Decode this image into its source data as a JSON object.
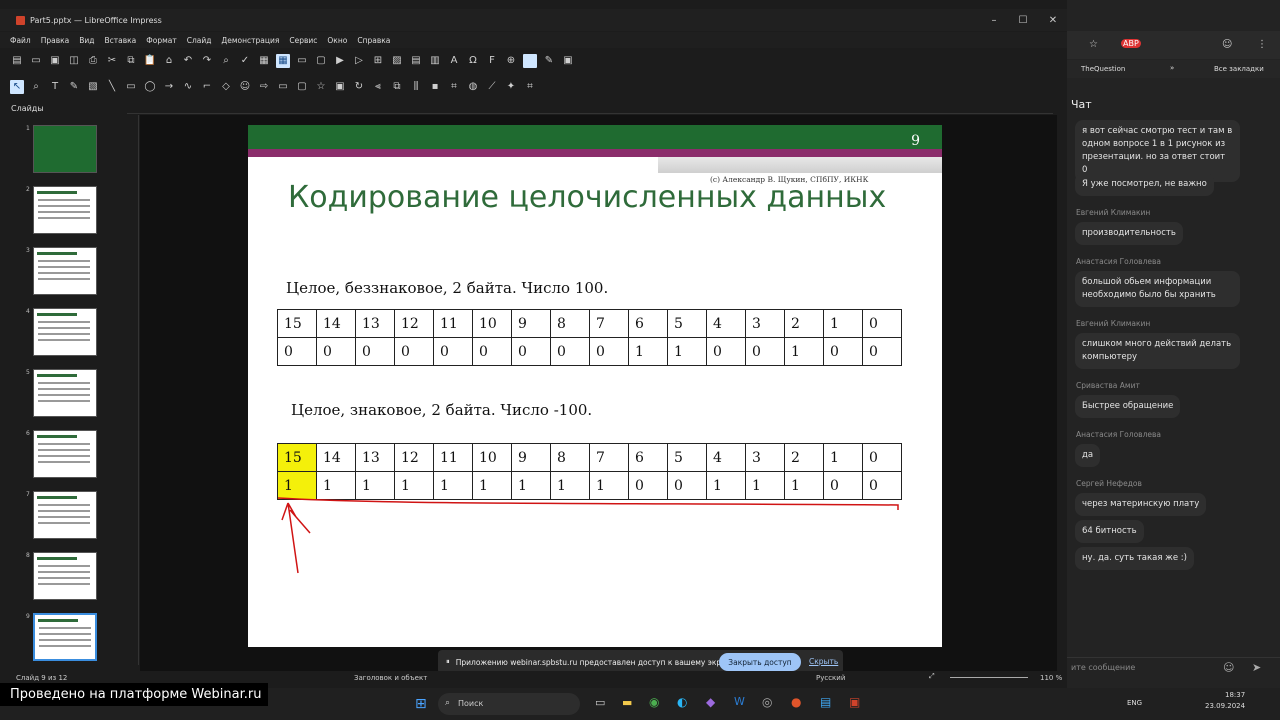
{
  "window": {
    "title": "Part5.pptx — LibreOffice Impress"
  },
  "menu": [
    "Файл",
    "Правка",
    "Вид",
    "Вставка",
    "Формат",
    "Слайд",
    "Демонстрация",
    "Сервис",
    "Окно",
    "Справка"
  ],
  "sidebar": {
    "header": "Слайды",
    "slide_numbers": [
      "1",
      "2",
      "3",
      "4",
      "5",
      "6",
      "7",
      "8",
      "9"
    ]
  },
  "slide": {
    "number": "9",
    "credit": "(с) Александр В. Щукин, СПбПУ, ИКНК",
    "title": "Кодирование целочисленных данных",
    "subtitle1": "Целое, беззнаковое, 2 байта. Число 100.",
    "subtitle2": "Целое, знаковое, 2 байта. Число -100.",
    "table1": {
      "header": [
        "15",
        "14",
        "13",
        "12",
        "11",
        "10",
        "9",
        "8",
        "7",
        "6",
        "5",
        "4",
        "3",
        "2",
        "1",
        "0"
      ],
      "bits": [
        "0",
        "0",
        "0",
        "0",
        "0",
        "0",
        "0",
        "0",
        "0",
        "1",
        "1",
        "0",
        "0",
        "1",
        "0",
        "0"
      ]
    },
    "table2": {
      "header": [
        "15",
        "14",
        "13",
        "12",
        "11",
        "10",
        "9",
        "8",
        "7",
        "6",
        "5",
        "4",
        "3",
        "2",
        "1",
        "0"
      ],
      "bits": [
        "1",
        "1",
        "1",
        "1",
        "1",
        "1",
        "1",
        "1",
        "1",
        "0",
        "0",
        "1",
        "1",
        "1",
        "0",
        "0"
      ]
    }
  },
  "statusbar": {
    "slide_info": "Слайд 9 из 12",
    "layout": "Заголовок и объект",
    "language": "Русский",
    "zoom": "110 %"
  },
  "share_bar": {
    "message": "Приложению webinar.spbstu.ru предоставлен доступ к вашему экрану.",
    "stop_button": "Закрыть доступ",
    "hide_link": "Скрыть"
  },
  "watermark": "Проведено на платформе Webinar.ru",
  "browser": {
    "bookmark1": "TheQuestion",
    "bookmark2": "Все закладки"
  },
  "chat": {
    "title": "Чат",
    "items": [
      {
        "author": "",
        "text": "я вот сейчас смотрю тест и там в одном вопросе 1 в 1 рисунок из презентации. но за ответ стоит 0"
      },
      {
        "author": "",
        "text": "Я уже посмотрел, не важно"
      },
      {
        "author": "Евгений Климакин",
        "text": "производительность"
      },
      {
        "author": "Анастасия Головлева",
        "text": "большой обьем информации необходимо было бы хранить"
      },
      {
        "author": "Евгений Климакин",
        "text": "слишком много действий делать компьютеру"
      },
      {
        "author": "Сриваства Амит",
        "text": "Быстрее обращение"
      },
      {
        "author": "Анастасия Головлева",
        "text": "да"
      },
      {
        "author": "Сергей Нефедов",
        "text": "через материнскую плату"
      },
      {
        "author": "",
        "text": "64 битность"
      },
      {
        "author": "",
        "text": "ну. да. суть такая же :)"
      }
    ],
    "input_placeholder": "ите сообщение"
  },
  "taskbar": {
    "search": "Поиск",
    "lang": "ENG",
    "time": "18:37",
    "date": "23.09.2024"
  }
}
